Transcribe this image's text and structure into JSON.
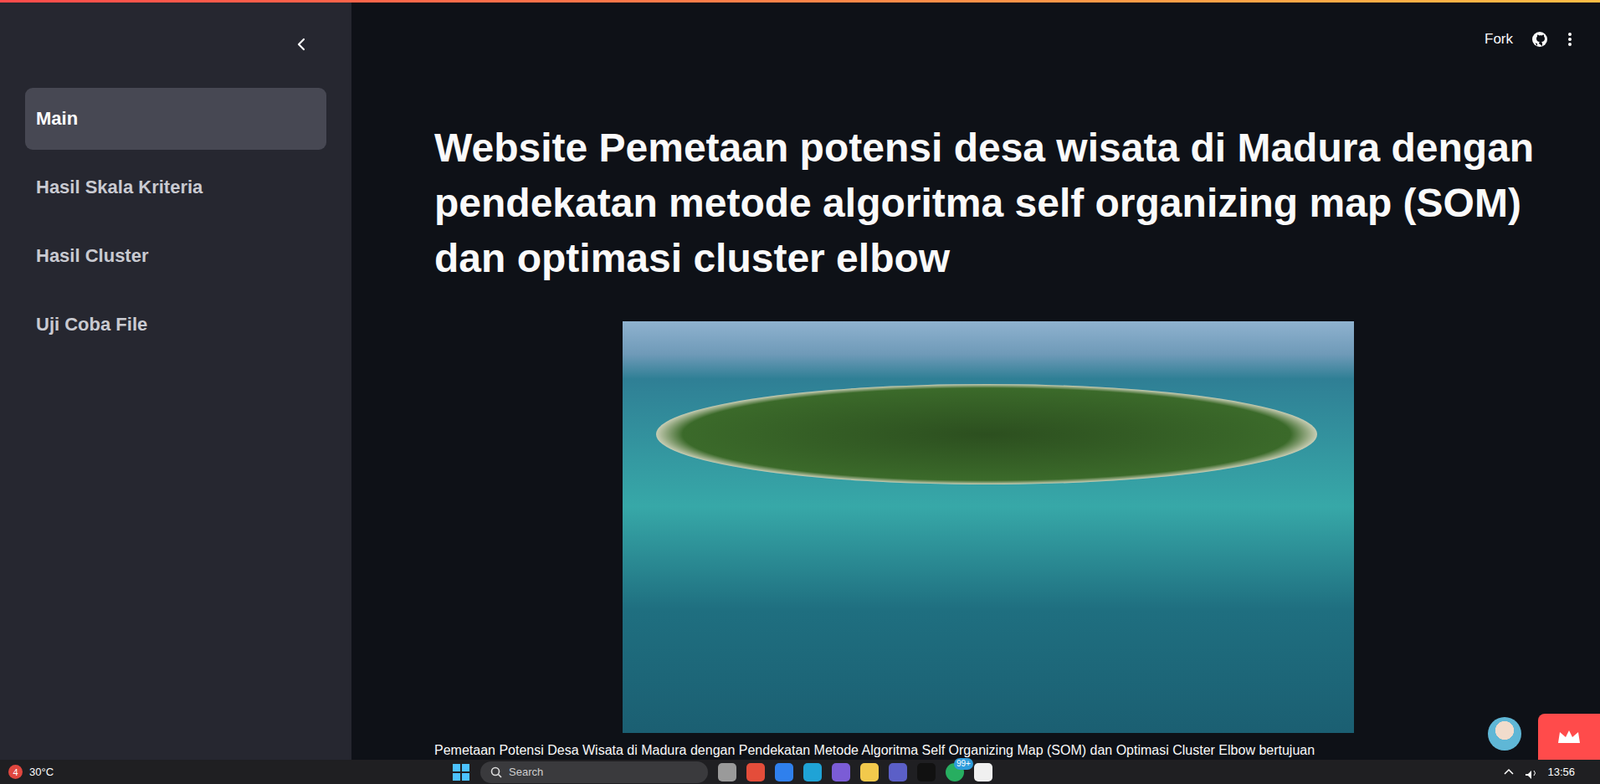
{
  "sidebar": {
    "items": [
      {
        "label": "Main",
        "selected": true
      },
      {
        "label": "Hasil Skala Kriteria",
        "selected": false
      },
      {
        "label": "Hasil Cluster",
        "selected": false
      },
      {
        "label": "Uji Coba File",
        "selected": false
      }
    ]
  },
  "header": {
    "fork": "Fork"
  },
  "title": "Website Pemetaan potensi desa wisata di Madura dengan pendekatan metode algoritma self organizing map (SOM) dan optimasi cluster elbow",
  "paragraph": "Pemetaan Potensi Desa Wisata di Madura dengan Pendekatan Metode Algoritma Self Organizing Map (SOM) dan Optimasi Cluster Elbow bertujuan",
  "taskbar": {
    "weather_badge": "4",
    "temperature": "30°C",
    "search_placeholder": "Search",
    "apps_badge": "99+",
    "time": "13:56"
  }
}
